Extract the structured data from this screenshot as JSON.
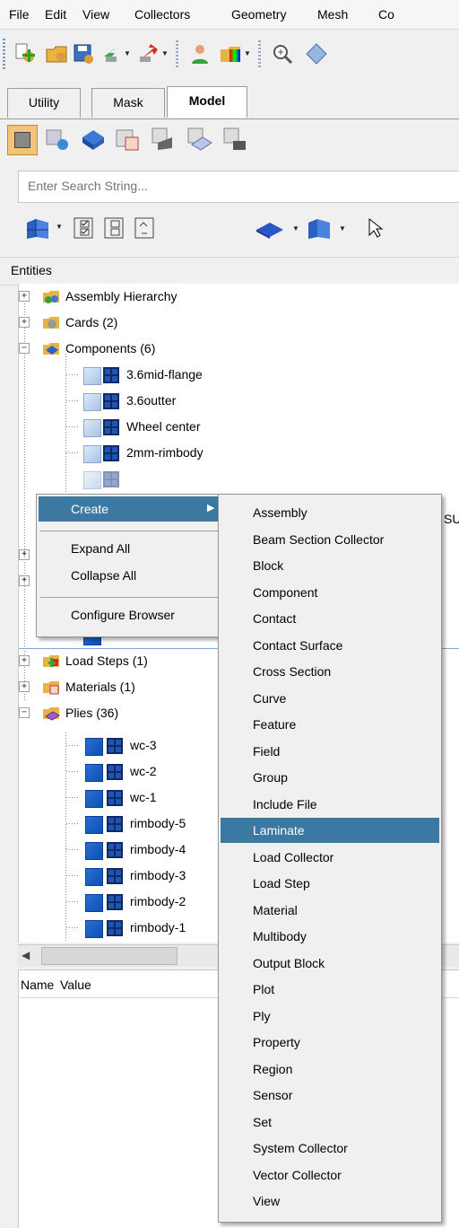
{
  "menubar": [
    "File",
    "Edit",
    "View",
    "Collectors",
    "Geometry",
    "Mesh",
    "Co"
  ],
  "toolbar_icons": [
    "add-part-icon",
    "open-folder-icon",
    "save-icon",
    "import-icon",
    "export-icon",
    "user-icon",
    "colors-icon",
    "zoom-icon",
    "view-diamond-icon"
  ],
  "tabs": [
    "Utility",
    "Mask",
    "Model"
  ],
  "search": {
    "placeholder": "Enter Search String..."
  },
  "entities_header": "Entities",
  "tree": {
    "top_items": [
      {
        "label": "Assembly Hierarchy",
        "icon": "assembly-icon"
      },
      {
        "label": "Cards (2)",
        "icon": "cards-icon"
      },
      {
        "label": "Components (6)",
        "icon": "components-icon"
      }
    ],
    "components": [
      "3.6mid-flange",
      "3.6outter",
      "Wheel center",
      "2mm-rimbody"
    ],
    "lower_items": [
      {
        "label": "Load Steps (1)",
        "icon": "loadsteps-icon"
      },
      {
        "label": "Materials (1)",
        "icon": "materials-icon"
      },
      {
        "label": "Plies (36)",
        "icon": "plies-icon"
      }
    ],
    "plies": [
      "wc-3",
      "wc-2",
      "wc-1",
      "rimbody-5",
      "rimbody-4",
      "rimbody-3",
      "rimbody-2",
      "rimbody-1"
    ],
    "partial_text": "SU"
  },
  "props_header": {
    "name": "Name",
    "value": "Value"
  },
  "context_menu": {
    "items": [
      "Create",
      "Expand All",
      "Collapse All",
      "Configure Browser"
    ],
    "highlighted": "Create"
  },
  "create_submenu": {
    "items": [
      "Assembly",
      "Beam Section Collector",
      "Block",
      "Component",
      "Contact",
      "Contact Surface",
      "Cross Section",
      "Curve",
      "Feature",
      "Field",
      "Group",
      "Include File",
      "Laminate",
      "Load Collector",
      "Load Step",
      "Material",
      "Multibody",
      "Output Block",
      "Plot",
      "Ply",
      "Property",
      "Region",
      "Sensor",
      "Set",
      "System Collector",
      "Vector Collector",
      "View"
    ],
    "highlighted": "Laminate"
  },
  "colors": {
    "highlight": "#3b79a3"
  }
}
